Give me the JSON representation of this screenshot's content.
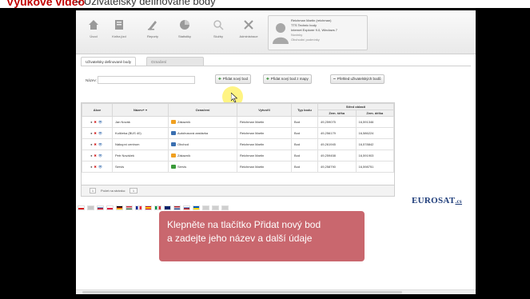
{
  "page_heading": {
    "lead": "Výukové video",
    "rest": "– Uživatelsky definované body"
  },
  "toolbar": {
    "buttons": [
      {
        "label": "Úvod",
        "icon": "house-icon"
      },
      {
        "label": "Kniha jízd",
        "icon": "book-icon"
      },
      {
        "label": "Reporty",
        "icon": "pen-icon"
      },
      {
        "label": "Statistiky",
        "icon": "chart-icon"
      },
      {
        "label": "Služby",
        "icon": "search-icon"
      },
      {
        "label": "Administrace",
        "icon": "tools-icon"
      }
    ]
  },
  "user": {
    "name": "Reichman Martin (reichman)",
    "company": "TTS Technic body",
    "browser": "Internet Explorer 9.0, Windows 7",
    "line4": "Novinky",
    "line5": "Obchodní podmínky"
  },
  "tabs": [
    {
      "label": "Uživatelsky definované body",
      "active": true
    },
    {
      "label": "Označení",
      "active": false
    }
  ],
  "filter": {
    "name_label": "Název:",
    "name_value": ""
  },
  "actions": {
    "add_point": "Přidat nový bod",
    "add_from_map": "Přidat nový bod z mapy",
    "overview": "Přehled uživatelských bodů"
  },
  "table": {
    "headers": {
      "action": "Akce",
      "name": "Název+ ▾",
      "label": "Označení",
      "created": "Vytvořil",
      "type": "Typ bodu",
      "center": "Střed oblasti",
      "lat": "Zem. šířka",
      "lon": "Zem. délka"
    },
    "rows": [
      {
        "name": "Jan Novák",
        "label": "Zákazník",
        "label_color": "#f0a020",
        "created": "Reichman Martin",
        "type": "Bod",
        "lat": "49,259075",
        "lon": "16,591346"
      },
      {
        "name": "Kuličeka (BUS 40)",
        "label": "Autobusová zastávka",
        "label_color": "#3a6fb0",
        "created": "Reichman Martin",
        "type": "Bod",
        "lat": "49,256179",
        "lon": "16,586224"
      },
      {
        "name": "Nákupní centrum",
        "label": "Obchod",
        "label_color": "#3a6fb0",
        "created": "Reichman Martin",
        "type": "Bod",
        "lat": "49,261945",
        "lon": "16,578842"
      },
      {
        "name": "Petr Nováček",
        "label": "Zákazník",
        "label_color": "#f0a020",
        "created": "Reichman Martin",
        "type": "Bod",
        "lat": "49,259458",
        "lon": "16,591903"
      },
      {
        "name": "Servis",
        "label": "Servis",
        "label_color": "#3a9a3a",
        "created": "Reichman Martin",
        "type": "Bod",
        "lat": "49,258790",
        "lon": "16,598751"
      }
    ]
  },
  "pager": {
    "page": "1",
    "per_page_label": "Počet na stránku:",
    "per_page_value": "1"
  },
  "brand": {
    "name": "EUROSAT",
    "suffix": ".cs"
  },
  "callout": {
    "line1": "Klepněte na tlačítko Přidat nový bod",
    "line2": "a zadejte jeho název a další údaje"
  },
  "colors": {
    "accent_red": "#c00000",
    "callout": "#c45a62",
    "brand_blue": "#1f3d7a",
    "plus_green": "#2e8b2e"
  }
}
